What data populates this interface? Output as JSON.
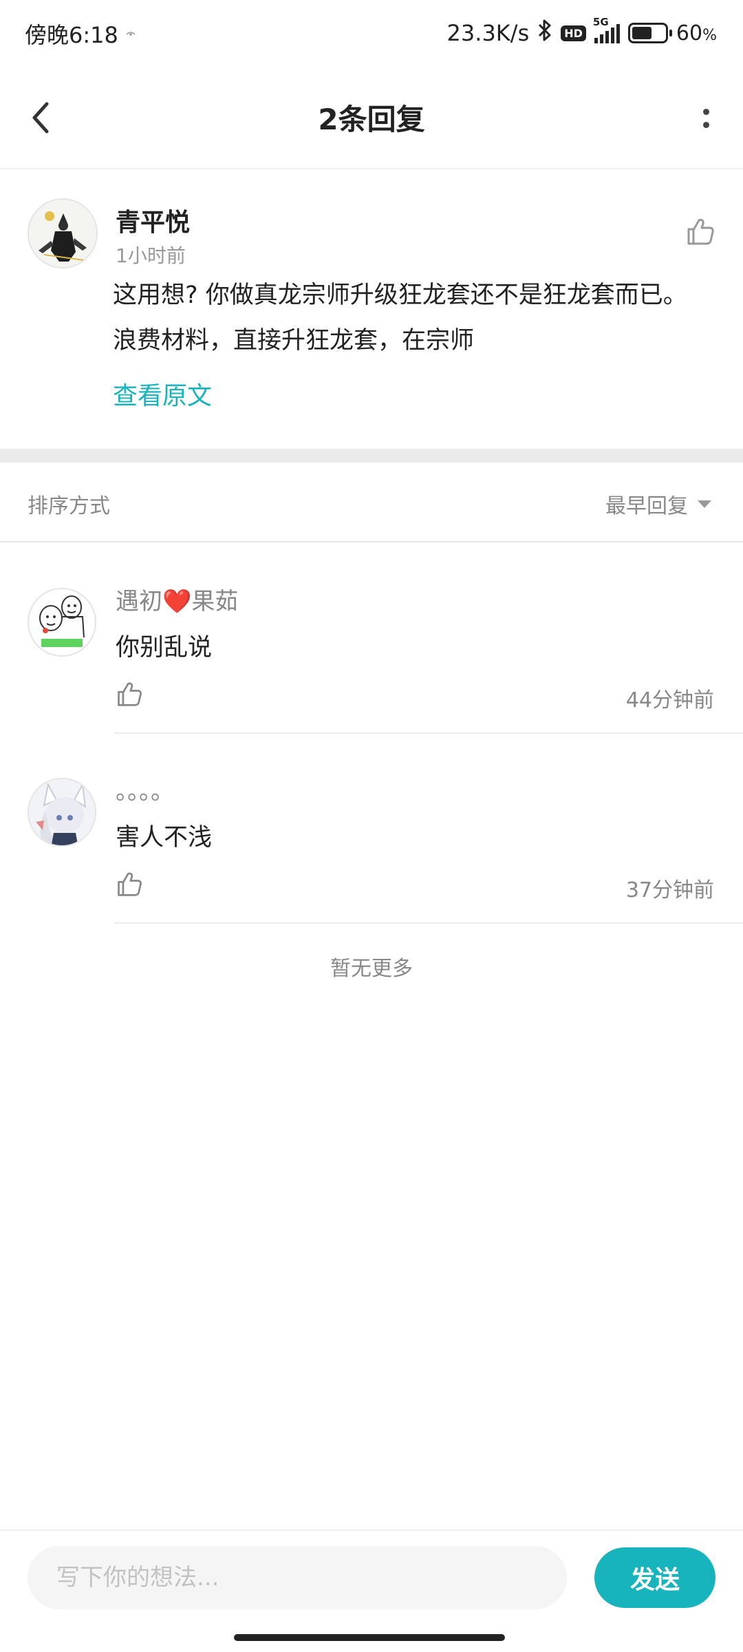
{
  "status_bar": {
    "time": "傍晚6:18",
    "network_speed": "23.3K/s",
    "hd_badge": "HD",
    "network_type": "5G",
    "battery_level": 0.6,
    "battery_text": "60",
    "battery_unit": "%"
  },
  "header": {
    "title": "2条回复"
  },
  "main_comment": {
    "author": "青平悦",
    "time": "1小时前",
    "text": "这用想? 你做真龙宗师升级狂龙套还不是狂龙套而已。浪费材料，直接升狂龙套，在宗师",
    "view_original": "查看原文"
  },
  "sort": {
    "label": "排序方式",
    "selected": "最早回复"
  },
  "replies": [
    {
      "author": "遇初❤️果茹",
      "text": "你别乱说",
      "time": "44分钟前"
    },
    {
      "author": "。。。。",
      "text": "害人不浅",
      "time": "37分钟前"
    }
  ],
  "footer_text": "暂无更多",
  "composer": {
    "placeholder": "写下你的想法...",
    "send_label": "发送"
  },
  "colors": {
    "accent": "#17b4be",
    "secondary_text": "#888888",
    "divider": "#ebebeb"
  }
}
